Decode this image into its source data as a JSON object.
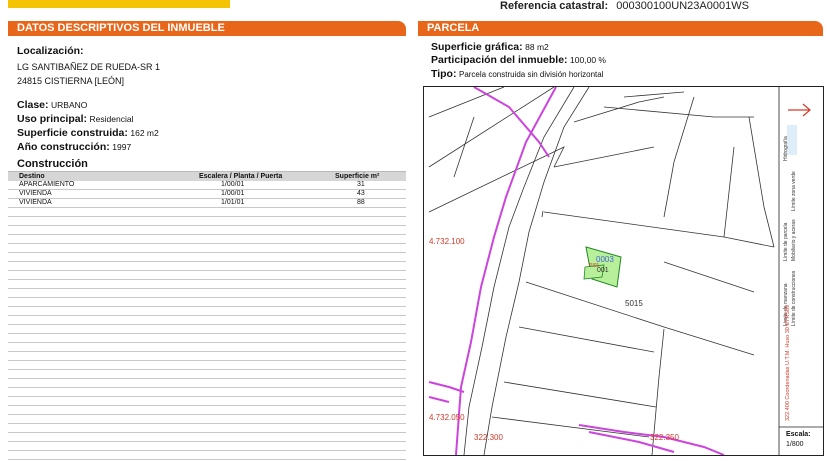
{
  "header": {
    "ref_label": "Referencia catastral:",
    "ref_value": "000300100UN23A0001WS"
  },
  "left": {
    "section_title": "DATOS DESCRIPTIVOS DEL INMUEBLE",
    "localizacion_label": "Localización:",
    "address_line1": "LG SANTIBAÑEZ DE RUEDA-SR 1",
    "address_line2": "24815 CISTIERNA [LEÓN]",
    "clase_label": "Clase:",
    "clase_value": "URBANO",
    "uso_label": "Uso principal:",
    "uso_value": "Residencial",
    "sup_label": "Superficie construida:",
    "sup_value": "162 m2",
    "anio_label": "Año construcción:",
    "anio_value": "1997",
    "construccion_title": "Construcción",
    "table": {
      "headers": [
        "Destino",
        "Escalera / Planta / Puerta",
        "Superficie m²"
      ],
      "rows": [
        [
          "APARCAMIENTO",
          "1/00/01",
          "31"
        ],
        [
          "VIVIENDA",
          "1/00/01",
          "43"
        ],
        [
          "VIVIENDA",
          "1/01/01",
          "88"
        ]
      ]
    }
  },
  "right": {
    "section_title": "PARCELA",
    "sup_grafica_label": "Superficie gráfica:",
    "sup_grafica_value": "88 m2",
    "participacion_label": "Participación del inmueble:",
    "participacion_value": "100,00 %",
    "tipo_label": "Tipo:",
    "tipo_value": "Parcela construida sin división horizontal"
  },
  "map": {
    "y_labels": [
      "4.732.100",
      "4.732.050"
    ],
    "x_labels": [
      "322.300",
      "322.350"
    ],
    "parcel_number": "5015",
    "building_labels": [
      "0003",
      "001"
    ],
    "building_small": "PI01",
    "legend": {
      "hidrografia": "Hidrografía",
      "zona_verde": "Límite zona verde",
      "parcela": "Límite de parcela",
      "mobiliario": "Mobiliario y aceras",
      "manzana": "Límite de manzana",
      "construcciones": "Límite de construcciones",
      "coords": "322.400 Coordenadas U.T.M. Huso 30 ETRS89",
      "escala_label": "Escala:",
      "escala_value": "1/800"
    },
    "colors": {
      "manzana": "#cc44dd",
      "label_red": "#d63a2a",
      "building_fill": "#b7ef9a",
      "header_orange": "#e8661a",
      "logo_yellow": "#f5c400"
    }
  }
}
